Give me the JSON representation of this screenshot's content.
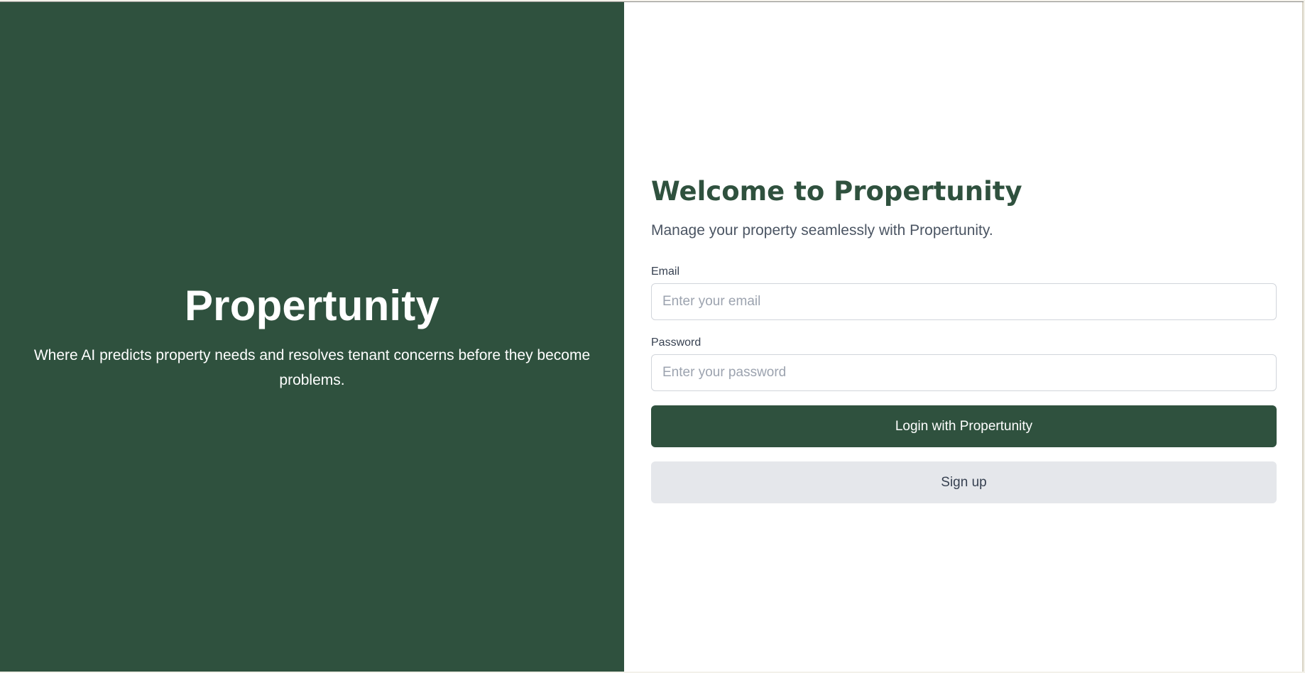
{
  "hero": {
    "title": "Propertunity",
    "tagline": "Where AI predicts property needs and resolves tenant concerns before they become problems."
  },
  "login": {
    "heading": "Welcome to Propertunity",
    "subtitle": "Manage your property seamlessly with Propertunity.",
    "email_label": "Email",
    "email_placeholder": "Enter your email",
    "email_value": "",
    "password_label": "Password",
    "password_placeholder": "Enter your password",
    "password_value": "",
    "login_button": "Login with Propertunity",
    "signup_button": "Sign up"
  },
  "colors": {
    "brand_green": "#2f513e",
    "secondary_button": "#e5e7eb",
    "muted_text": "#4b5563"
  }
}
